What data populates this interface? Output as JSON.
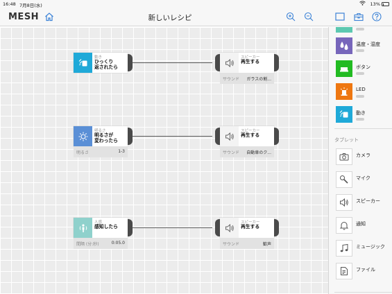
{
  "status_bar": {
    "time": "16:48",
    "date": "7月8日(水)",
    "battery_pct": "13%"
  },
  "nav": {
    "logo": "MESH",
    "title": "新しいレシピ"
  },
  "recipes": [
    {
      "trigger": {
        "category": "動き",
        "text": "ひっくり\n返されたら",
        "icon": "motion-icon",
        "color": "#1fa9d8"
      },
      "action": {
        "category": "スピーカー",
        "text": "再生する",
        "footer_label": "サウンド",
        "footer_value": "ガラスの割..."
      }
    },
    {
      "trigger": {
        "category": "明るさ",
        "text": "明るさが\n変わったら",
        "icon": "brightness-icon",
        "color": "#5a8fd6",
        "footer_label": "明るさ",
        "footer_value": "1-3"
      },
      "action": {
        "category": "スピーカー",
        "text": "再生する",
        "footer_label": "サウンド",
        "footer_value": "自動車のク..."
      }
    },
    {
      "trigger": {
        "category": "人感",
        "text": "感知したら",
        "icon": "motion-sensor-icon",
        "color": "#8fd1cc",
        "footer_label": "間隔 (分:秒)",
        "footer_value": "0:05.0"
      },
      "action": {
        "category": "スピーカー",
        "text": "再生する",
        "footer_label": "サウンド",
        "footer_value": "歓声"
      }
    }
  ],
  "panel": {
    "items": [
      {
        "label": "温度・湿度",
        "icon": "temperature-humidity-icon",
        "color": "#7766bb"
      },
      {
        "label": "ボタン",
        "icon": "button-icon",
        "color": "#22bb22"
      },
      {
        "label": "LED",
        "icon": "led-icon",
        "color": "#ee7711"
      },
      {
        "label": "動き",
        "icon": "motion-icon",
        "color": "#1fa9d8"
      }
    ],
    "tablet_section": "タブレット",
    "tablet_items": [
      {
        "label": "カメラ",
        "icon": "camera-icon"
      },
      {
        "label": "マイク",
        "icon": "microphone-icon"
      },
      {
        "label": "スピーカー",
        "icon": "speaker-icon"
      },
      {
        "label": "通知",
        "icon": "bell-icon"
      },
      {
        "label": "ミュージック",
        "icon": "music-icon"
      },
      {
        "label": "ファイル",
        "icon": "file-icon"
      }
    ]
  },
  "colors": {
    "accent": "#3b82d6",
    "teal_tile": "#5cc8b0",
    "wire": "#555555"
  }
}
